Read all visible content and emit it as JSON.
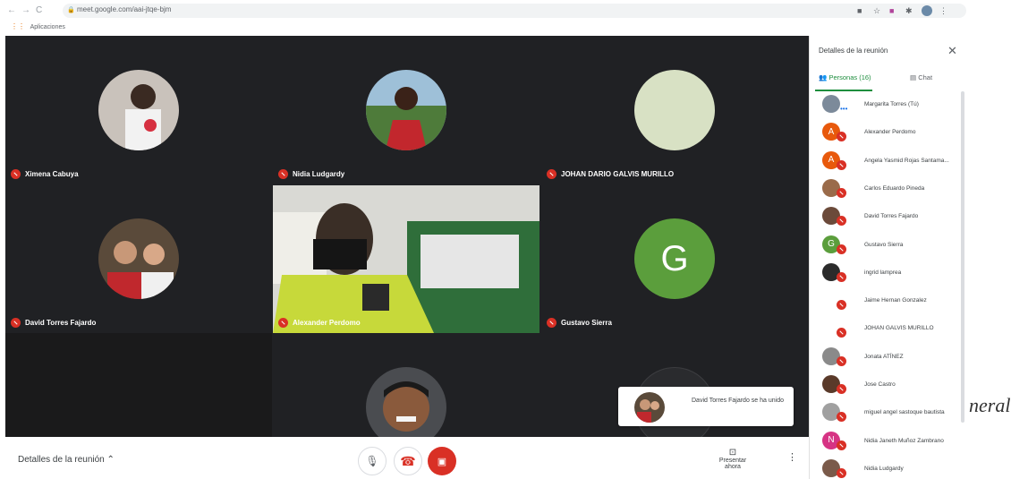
{
  "browser": {
    "url": "meet.google.com/aai-jtqe-bjm",
    "bookmarks_label": "Aplicaciones"
  },
  "grid": {
    "tiles": [
      {
        "name": "Ximena Cabuya"
      },
      {
        "name": "Nidia Ludgardy"
      },
      {
        "name": "JOHAN DARIO GALVIS MURILLO"
      },
      {
        "name": "David Torres Fajardo"
      },
      {
        "name": "Alexander Perdomo"
      },
      {
        "name": "Gustavo Sierra",
        "initial": "G"
      }
    ]
  },
  "toast": {
    "text": "David Torres Fajardo se ha unido"
  },
  "bottombar": {
    "details_label": "Detalles de la reunión",
    "present_label": "Presentar ahora"
  },
  "panel": {
    "title": "Detalles de la reunión",
    "tab_people": "Personas (16)",
    "tab_chat": "Chat",
    "people": [
      {
        "name": "Margarita Torres (Tú)",
        "color": "#7c8a9a"
      },
      {
        "name": "Alexander Perdomo",
        "initial": "A",
        "color": "#e8590c"
      },
      {
        "name": "Angela Yasmid Rojas Santama...",
        "initial": "A",
        "color": "#e8590c"
      },
      {
        "name": "Carlos Eduardo Pineda",
        "color": "#9a6b4a"
      },
      {
        "name": "David Torres Fajardo",
        "color": "#6b4a3a"
      },
      {
        "name": "Gustavo Sierra",
        "initial": "G",
        "color": "#5b9e3c"
      },
      {
        "name": "ingrid lamprea",
        "color": "#2b2b2b"
      },
      {
        "name": "Jaime Hernan Gonzalez",
        "color": "#ffffff"
      },
      {
        "name": "JOHAN      GALVIS MURILLO",
        "color": "#ffffff"
      },
      {
        "name": "Jonata     ATÍNEZ",
        "color": "#8a8a8a"
      },
      {
        "name": "Jose Castro",
        "color": "#5a3a2a"
      },
      {
        "name": "miguel angel sastoque bautista",
        "color": "#a0a0a0"
      },
      {
        "name": "Nidia Janeth Muñoz Zambrano",
        "initial": "N",
        "color": "#d63384"
      },
      {
        "name": "Nidia Ludgardy",
        "color": "#7a5a4a"
      }
    ]
  },
  "stray_text": "neral"
}
